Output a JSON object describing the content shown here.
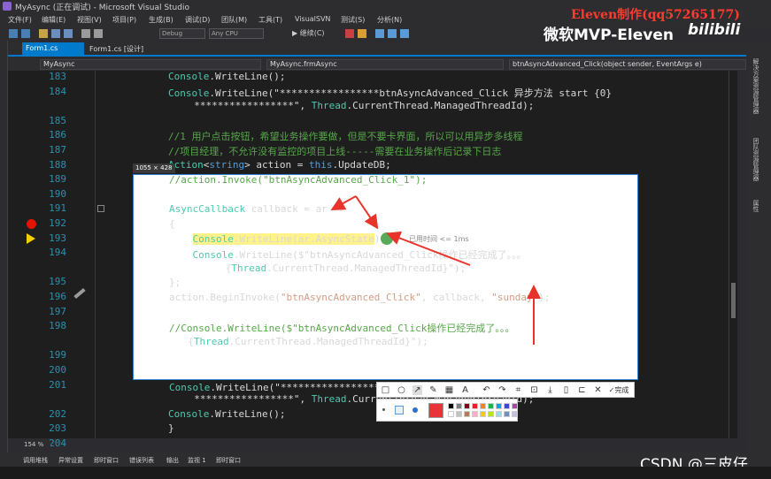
{
  "window": {
    "title": "MyAsync (正在调试) - Microsoft Visual Studio"
  },
  "watermark": {
    "author_tag": "Eleven制作(qq57265177)",
    "mvp": "微软MVP-Eleven",
    "platform": "bilibili",
    "csdn": "CSDN @三皮仔"
  },
  "menu": [
    "文件(F)",
    "编辑(E)",
    "视图(V)",
    "项目(P)",
    "生成(B)",
    "调试(D)",
    "团队(M)",
    "工具(T)",
    "VisualSVN",
    "测试(S)",
    "分析(N)"
  ],
  "toolbar": {
    "config": "Debug",
    "platform": "Any CPU",
    "start_label": "▶ 继续(C)"
  },
  "tabs": [
    {
      "label": "Form1.cs",
      "active": true
    },
    {
      "label": "Form1.cs [设计]",
      "active": false
    }
  ],
  "navbar": {
    "project": "MyAsync",
    "class": "MyAsync.frmAsync",
    "member": "btnAsyncAdvanced_Click(object sender, EventArgs e)"
  },
  "screenshot_tool": {
    "size": "1055 × 428",
    "elapsed": "已用时间 <= 1ms",
    "done_label": "完成"
  },
  "zoom": "154 %",
  "bottom_tabs": [
    "调用堆栈",
    "异常设置",
    "即时窗口",
    "错误列表",
    "输出",
    "监视 1",
    "即时窗口"
  ],
  "code": [
    {
      "n": "183",
      "text": "Console.WriteLine();"
    },
    {
      "n": "184",
      "text": "Console.WriteLine(\"*****************btnAsyncAdvanced_Click 异步方法 start {0}"
    },
    {
      "n": "",
      "text": "  *****************\", Thread.CurrentThread.ManagedThreadId);"
    },
    {
      "n": "185",
      "text": ""
    },
    {
      "n": "186",
      "text": "//1 用户点击按钮，希望业务操作要做，但是不要卡界面，所以可以用异步多线程"
    },
    {
      "n": "187",
      "text": "//项目经理，不允许没有监控的项目上线-----需要在业务操作后记录下日志"
    },
    {
      "n": "188",
      "text": "Action<string> action = this.UpdateDB;"
    },
    {
      "n": "189",
      "text": "//action.Invoke(\"btnAsyncAdvanced_Click_1\");"
    },
    {
      "n": "190",
      "text": ""
    },
    {
      "n": "191",
      "text": "AsyncCallback callback = ar =>"
    },
    {
      "n": "192",
      "text": "{"
    },
    {
      "n": "193",
      "text": "    Console.WriteLine(ar.AsyncState);"
    },
    {
      "n": "194",
      "text": "    Console.WriteLine($\"btnAsyncAdvanced_Click操作已经完成了。。。"
    },
    {
      "n": "",
      "text": "      {Thread.CurrentThread.ManagedThreadId}\");"
    },
    {
      "n": "195",
      "text": "};"
    },
    {
      "n": "196",
      "text": "action.BeginInvoke(\"btnAsyncAdvanced_Click\", callback, \"sunday\");"
    },
    {
      "n": "197",
      "text": ""
    },
    {
      "n": "198",
      "text": "//Console.WriteLine($\"btnAsyncAdvanced_Click操作已经完成了。。。"
    },
    {
      "n": "",
      "text": "  {Thread.CurrentThread.ManagedThreadId}\");"
    },
    {
      "n": "199",
      "text": ""
    },
    {
      "n": "200",
      "text": ""
    },
    {
      "n": "201",
      "text": "Console.WriteLine(\"*****************btnAsyncAdvanced_Click 异步方法 end {0}"
    },
    {
      "n": "",
      "text": "  *****************\", Thread.CurrentThread.ManagedThreadId);"
    },
    {
      "n": "202",
      "text": "Console.WriteLine();"
    },
    {
      "n": "203",
      "text": "}"
    },
    {
      "n": "204",
      "text": ""
    }
  ],
  "colors": {
    "accent": "#007acc",
    "arrow": "#e8332a",
    "highlight": "#fff28a",
    "breakpoint": "#e51400"
  },
  "icons": [
    "breakpoint-icon",
    "current-line-arrow-icon",
    "pen-icon",
    "rect-icon",
    "circle-icon",
    "arrow-icon",
    "text-icon",
    "undo-icon",
    "close-icon",
    "check-icon"
  ]
}
